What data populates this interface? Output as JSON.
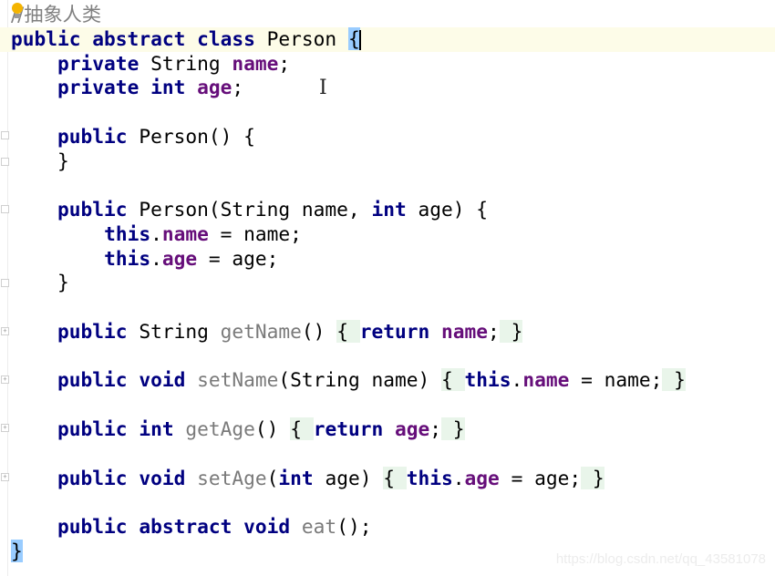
{
  "editor": {
    "colors": {
      "keyword": "#000080",
      "field": "#660e7a",
      "method": "#7a7a7a",
      "comment": "#808080",
      "current_line": "#fdfce8",
      "brace_match": "#99ccff",
      "folded_region": "#e9f5ea"
    },
    "current_line_index": 1,
    "lines": [
      [
        [
          "//抽象人类",
          "cmt"
        ]
      ],
      [
        [
          "public abstract class ",
          "kw"
        ],
        [
          "Person ",
          "plain"
        ],
        [
          "{",
          "brace-match"
        ]
      ],
      [
        [
          "    "
        ],
        [
          "private ",
          "kw"
        ],
        [
          "String ",
          "plain"
        ],
        [
          "name",
          "fld"
        ],
        [
          ";",
          "plain"
        ]
      ],
      [
        [
          "    "
        ],
        [
          "private int ",
          "kw"
        ],
        [
          "age",
          "fld"
        ],
        [
          ";",
          "plain"
        ]
      ],
      [],
      [
        [
          "    "
        ],
        [
          "public ",
          "kw"
        ],
        [
          "Person() {",
          "plain"
        ]
      ],
      [
        [
          "    }",
          "plain"
        ]
      ],
      [],
      [
        [
          "    "
        ],
        [
          "public ",
          "kw"
        ],
        [
          "Person(String name, ",
          "plain"
        ],
        [
          "int ",
          "kw"
        ],
        [
          "age) {",
          "plain"
        ]
      ],
      [
        [
          "        "
        ],
        [
          "this",
          "kw"
        ],
        [
          ".",
          "plain"
        ],
        [
          "name",
          "fld"
        ],
        [
          " = name;",
          "plain"
        ]
      ],
      [
        [
          "        "
        ],
        [
          "this",
          "kw"
        ],
        [
          ".",
          "plain"
        ],
        [
          "age",
          "fld"
        ],
        [
          " = age;",
          "plain"
        ]
      ],
      [
        [
          "    }",
          "plain"
        ]
      ],
      [],
      [
        [
          "    "
        ],
        [
          "public ",
          "kw"
        ],
        [
          "String ",
          "plain"
        ],
        [
          "getName",
          "mth"
        ],
        [
          "() ",
          "plain"
        ],
        [
          "{ ",
          "fb"
        ],
        [
          "return ",
          "kw"
        ],
        [
          "name",
          "fld"
        ],
        [
          ";",
          "plain"
        ],
        [
          " }",
          "fb"
        ]
      ],
      [],
      [
        [
          "    "
        ],
        [
          "public void ",
          "kw"
        ],
        [
          "setName",
          "mth"
        ],
        [
          "(String name) ",
          "plain"
        ],
        [
          "{ ",
          "fb"
        ],
        [
          "this",
          "kw"
        ],
        [
          ".",
          "plain"
        ],
        [
          "name",
          "fld"
        ],
        [
          " = name;",
          "plain"
        ],
        [
          " }",
          "fb"
        ]
      ],
      [],
      [
        [
          "    "
        ],
        [
          "public int ",
          "kw"
        ],
        [
          "getAge",
          "mth"
        ],
        [
          "() ",
          "plain"
        ],
        [
          "{ ",
          "fb"
        ],
        [
          "return ",
          "kw"
        ],
        [
          "age",
          "fld"
        ],
        [
          ";",
          "plain"
        ],
        [
          " }",
          "fb"
        ]
      ],
      [],
      [
        [
          "    "
        ],
        [
          "public void ",
          "kw"
        ],
        [
          "setAge",
          "mth"
        ],
        [
          "(",
          "plain"
        ],
        [
          "int ",
          "kw"
        ],
        [
          "age) ",
          "plain"
        ],
        [
          "{ ",
          "fb"
        ],
        [
          "this",
          "kw"
        ],
        [
          ".",
          "plain"
        ],
        [
          "age",
          "fld"
        ],
        [
          " = age;",
          "plain"
        ],
        [
          " }",
          "fb"
        ]
      ],
      [],
      [
        [
          "    "
        ],
        [
          "public abstract void ",
          "kw"
        ],
        [
          "eat",
          "mth"
        ],
        [
          "();",
          "plain"
        ]
      ],
      [
        [
          "}",
          "brace-match"
        ]
      ]
    ]
  },
  "icons": {
    "intention": "lightbulb-icon",
    "cursor": "text-cursor-icon"
  },
  "watermark": "https://blog.csdn.net/qq_43581078"
}
